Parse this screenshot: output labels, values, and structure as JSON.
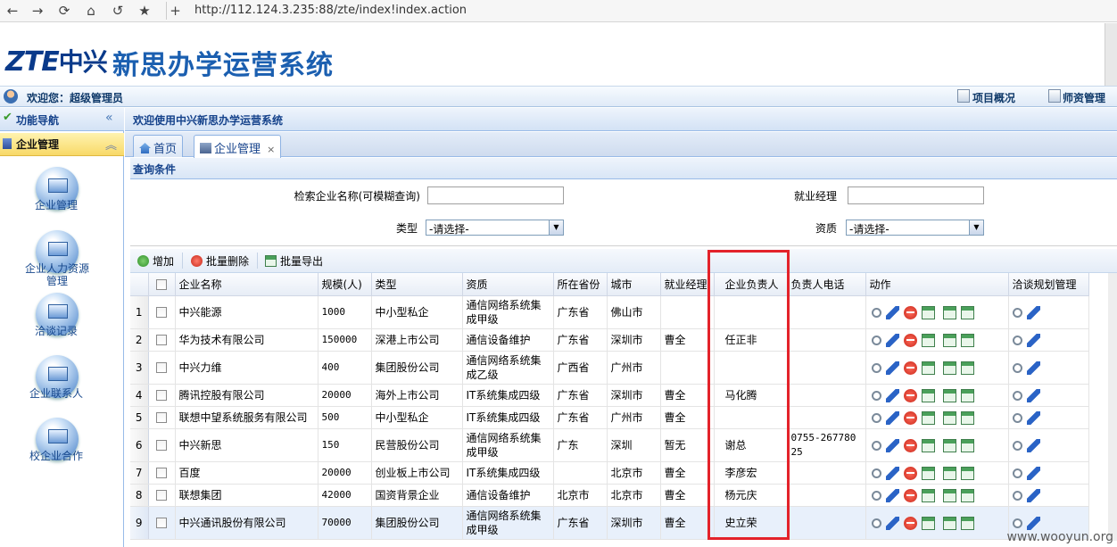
{
  "browser": {
    "url": "http://112.124.3.235:88/zte/index!index.action",
    "nav_icons": [
      "back-icon",
      "forward-icon",
      "refresh-icon",
      "home-icon",
      "history-icon",
      "star-icon",
      "new-tab-icon"
    ]
  },
  "header": {
    "logo_en": "ZTE",
    "logo_cn": "中兴",
    "system_title": "新思办学运营系统"
  },
  "userbar": {
    "welcome": "欢迎您：超级管理员",
    "project_overview": "项目概况",
    "teacher_mgmt": "师资管理"
  },
  "sidebar": {
    "title": "功能导航",
    "group": "企业管理",
    "items": [
      {
        "label": "企业管理"
      },
      {
        "label": "企业人力资源管理"
      },
      {
        "label": "洽谈记录"
      },
      {
        "label": "企业联系人"
      },
      {
        "label": "校企业合作"
      }
    ]
  },
  "main": {
    "banner": "欢迎使用中兴新思办学运营系统",
    "tabs": [
      {
        "label": "首页"
      },
      {
        "label": "企业管理",
        "close": "×"
      }
    ],
    "query": {
      "title": "查询条件",
      "name_label": "检索企业名称(可模糊查询)",
      "name_value": "",
      "manager_label": "就业经理",
      "manager_value": "",
      "type_label": "类型",
      "type_value": "-请选择-",
      "qual_label": "资质",
      "qual_value": "-请选择-"
    },
    "toolbar": {
      "add": "增加",
      "batch_delete": "批量删除",
      "batch_export": "批量导出"
    },
    "table": {
      "headers": [
        "企业名称",
        "规模(人)",
        "类型",
        "资质",
        "所在省份",
        "城市",
        "就业经理",
        "企业负责人",
        "负责人电话",
        "动作",
        "洽谈规划管理"
      ],
      "rows": [
        {
          "n": "1",
          "name": "中兴能源",
          "size": "1000",
          "type": "中小型私企",
          "qual": "通信网络系统集成甲级",
          "prov": "广东省",
          "city": "佛山市",
          "mgr": "",
          "head": "",
          "phone": ""
        },
        {
          "n": "2",
          "name": "华为技术有限公司",
          "size": "150000",
          "type": "深港上市公司",
          "qual": "通信设备维护",
          "prov": "广东省",
          "city": "深圳市",
          "mgr": "曹全",
          "head": "任正非",
          "phone": ""
        },
        {
          "n": "3",
          "name": "中兴力维",
          "size": "400",
          "type": "集团股份公司",
          "qual": "通信网络系统集成乙级",
          "prov": "广西省",
          "city": "广州市",
          "mgr": "",
          "head": "",
          "phone": ""
        },
        {
          "n": "4",
          "name": "腾讯控股有限公司",
          "size": "20000",
          "type": "海外上市公司",
          "qual": "IT系统集成四级",
          "prov": "广东省",
          "city": "深圳市",
          "mgr": "曹全",
          "head": "马化腾",
          "phone": ""
        },
        {
          "n": "5",
          "name": "联想中望系统服务有限公司",
          "size": "500",
          "type": "中小型私企",
          "qual": "IT系统集成四级",
          "prov": "广东省",
          "city": "广州市",
          "mgr": "曹全",
          "head": "",
          "phone": ""
        },
        {
          "n": "6",
          "name": "中兴新思",
          "size": "150",
          "type": "民营股份公司",
          "qual": "通信网络系统集成甲级",
          "prov": "广东",
          "city": "深圳",
          "mgr": "暂无",
          "head": "谢总",
          "phone": "0755-26778025"
        },
        {
          "n": "7",
          "name": "百度",
          "size": "20000",
          "type": "创业板上市公司",
          "qual": "IT系统集成四级",
          "prov": "",
          "city": "北京市",
          "mgr": "曹全",
          "head": "李彦宏",
          "phone": ""
        },
        {
          "n": "8",
          "name": "联想集团",
          "size": "42000",
          "type": "国资背景企业",
          "qual": "通信设备维护",
          "prov": "北京市",
          "city": "北京市",
          "mgr": "曹全",
          "head": "杨元庆",
          "phone": ""
        },
        {
          "n": "9",
          "name": "中兴通讯股份有限公司",
          "size": "70000",
          "type": "集团股份公司",
          "qual": "通信网络系统集成甲级",
          "prov": "广东省",
          "city": "深圳市",
          "mgr": "曹全",
          "head": "史立荣",
          "phone": ""
        }
      ]
    }
  },
  "watermark": "www.wooyun.org",
  "colors": {
    "accent_blue": "#15428b",
    "highlight_red": "#e3222a",
    "group_yellow": "#f8d968"
  }
}
